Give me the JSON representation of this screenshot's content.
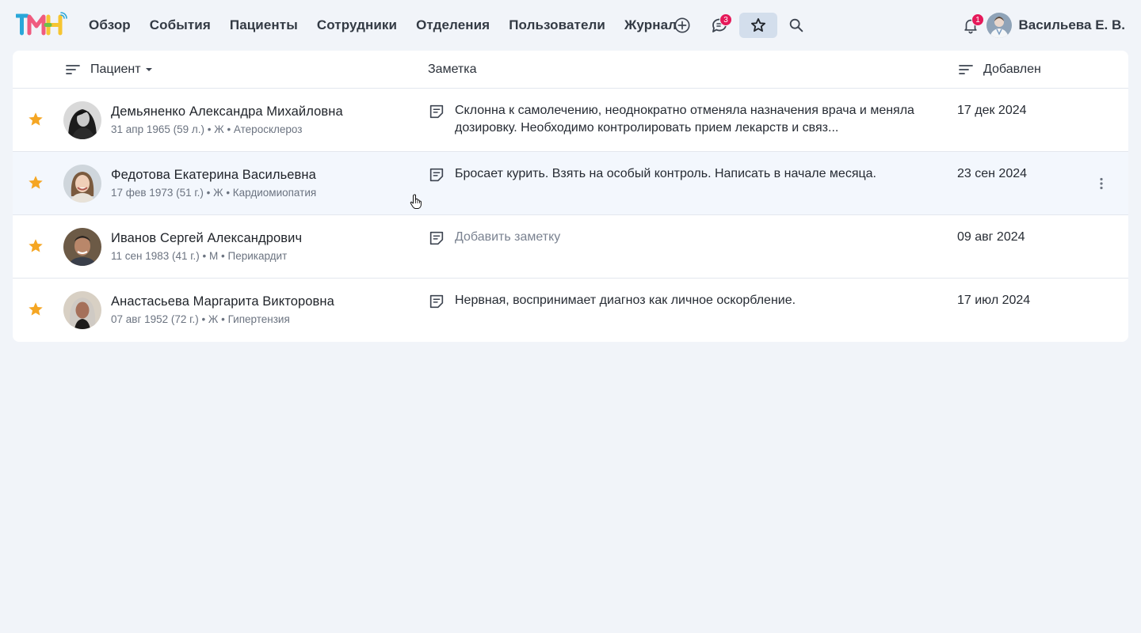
{
  "nav": {
    "items": [
      "Обзор",
      "События",
      "Пациенты",
      "Сотрудники",
      "Отделения",
      "Пользователи",
      "Журнал"
    ]
  },
  "toolbar": {
    "add_icon": "plus-circle-icon",
    "chat_icon": "chat-bubble-icon",
    "chat_badge": "3",
    "favorites_icon": "star-outline-icon",
    "search_icon": "search-icon",
    "notifications_icon": "bell-icon",
    "notifications_badge": "1"
  },
  "user": {
    "name": "Васильева Е. В."
  },
  "table": {
    "columns": {
      "patient": "Пациент",
      "note": "Заметка",
      "added": "Добавлен"
    },
    "rows": [
      {
        "name": "Демьяненко Александра Михайловна",
        "meta": "31 апр 1965 (59 л.) • Ж • Атеросклероз",
        "note": "Склонна к самолечению, неоднократно отменяла назначения врача и меняла дозировку. Необходимо контролировать прием лекарств и связ...",
        "note_is_placeholder": false,
        "date": "17 дек 2024"
      },
      {
        "name": "Федотова Екатерина Васильевна",
        "meta": "17 фев 1973 (51 г.) • Ж • Кардиомиопатия",
        "note": "Бросает курить. Взять на особый контроль. Написать в начале месяца.",
        "note_is_placeholder": false,
        "date": "23 сен 2024"
      },
      {
        "name": "Иванов Сергей Александрович",
        "meta": "11 сен 1983 (41 г.) • М • Перикардит",
        "note": "Добавить заметку",
        "note_is_placeholder": true,
        "date": "09 авг 2024"
      },
      {
        "name": "Анастасьева Маргарита Викторовна",
        "meta": "07 авг 1952 (72 г.) • Ж • Гипертензия",
        "note": "Нервная, воспринимает диагноз как личное оскорбление.",
        "note_is_placeholder": false,
        "date": "17 июл 2024"
      }
    ]
  },
  "colors": {
    "accent_star": "#f5a623",
    "badge": "#e5195a",
    "page_bg": "#f1f4f9",
    "active_button_bg": "#d3deec"
  }
}
